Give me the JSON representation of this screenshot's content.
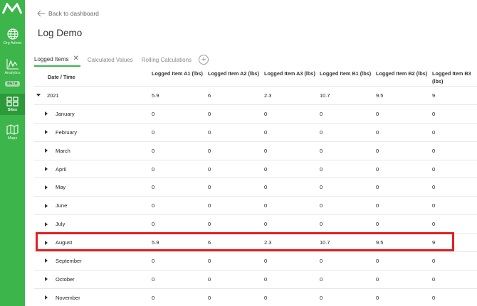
{
  "sidebar": {
    "items": [
      {
        "icon": "globe-icon",
        "label": "Org Admin"
      },
      {
        "icon": "analytics-icon",
        "label": "Analytics",
        "badge": "BETA"
      },
      {
        "icon": "sites-icon",
        "label": "Sites",
        "active": true
      },
      {
        "icon": "map-icon",
        "label": "Maps"
      }
    ],
    "accent": "#3cb54a"
  },
  "header": {
    "back_label": "Back to dashboard",
    "title": "Log Demo"
  },
  "tabs": [
    {
      "label": "Logged Items",
      "active": true,
      "closable": true
    },
    {
      "label": "Calculated Values"
    },
    {
      "label": "Rolling Calculations"
    }
  ],
  "table": {
    "columns": [
      "Date / Time",
      "Logged Item A1 (lbs)",
      "Logged Item A2 (lbs)",
      "Logged Item A3 (lbs)",
      "Logged Item B1 (lbs)",
      "Logged Item B2 (lbs)",
      "Logged Item B3 (lbs)"
    ],
    "rows": [
      {
        "label": "2021",
        "expanded": true,
        "values": [
          "5.9",
          "6",
          "2.3",
          "10.7",
          "9.5",
          "9"
        ]
      },
      {
        "label": "January",
        "values": [
          "0",
          "0",
          "0",
          "0",
          "0",
          "0"
        ]
      },
      {
        "label": "February",
        "values": [
          "0",
          "0",
          "0",
          "0",
          "0",
          "0"
        ]
      },
      {
        "label": "March",
        "values": [
          "0",
          "0",
          "0",
          "0",
          "0",
          "0"
        ]
      },
      {
        "label": "April",
        "values": [
          "0",
          "0",
          "0",
          "0",
          "0",
          "0"
        ]
      },
      {
        "label": "May",
        "values": [
          "0",
          "0",
          "0",
          "0",
          "0",
          "0"
        ]
      },
      {
        "label": "June",
        "values": [
          "0",
          "0",
          "0",
          "0",
          "0",
          "0"
        ]
      },
      {
        "label": "July",
        "values": [
          "0",
          "0",
          "0",
          "0",
          "0",
          "0"
        ]
      },
      {
        "label": "August",
        "highlighted": true,
        "values": [
          "5.9",
          "6",
          "2.3",
          "10.7",
          "9.5",
          "9"
        ]
      },
      {
        "label": "September",
        "values": [
          "0",
          "0",
          "0",
          "0",
          "0",
          "0"
        ]
      },
      {
        "label": "October",
        "values": [
          "0",
          "0",
          "0",
          "0",
          "0",
          "0"
        ]
      },
      {
        "label": "November",
        "values": [
          "0",
          "0",
          "0",
          "0",
          "0",
          "0"
        ]
      }
    ]
  },
  "highlight_color": "#e02020"
}
